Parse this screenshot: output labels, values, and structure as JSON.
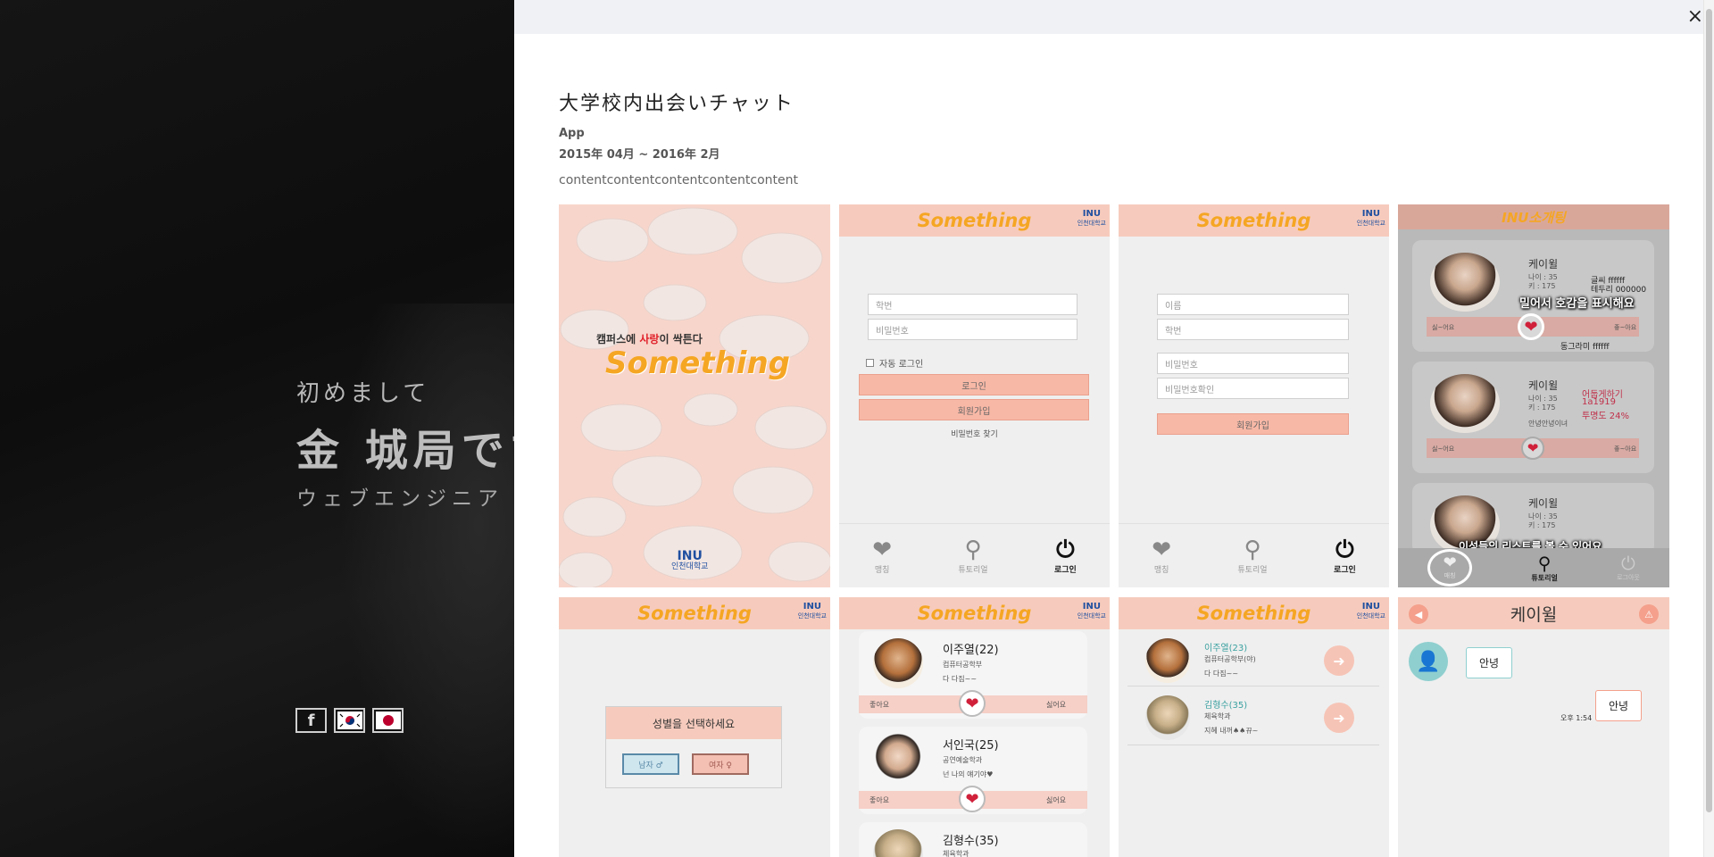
{
  "hero": {
    "greeting": "初めまして",
    "name": "金 城局です",
    "role": "ウェブエンジニア"
  },
  "social": {
    "facebook": "f",
    "korea_icon": "korea-flag-icon",
    "japan_icon": "japan-flag-icon"
  },
  "modal": {
    "close": "×",
    "title": "大学校内出会いチャット",
    "category": "App",
    "period": "2015年 04月 ~ 2016年 2月",
    "description": "contentcontentcontentcontentcontent"
  },
  "app": {
    "logo": "Something",
    "inu": "INU",
    "inu_sub": "인천대학교",
    "splash_tagline_pre": "캠퍼스에 ",
    "splash_tagline_red": "사랑",
    "splash_tagline_post": "이 싹튼다",
    "login": {
      "student_id": "학번",
      "password": "비밀번호",
      "auto_login": "자동 로그인",
      "login_btn": "로그인",
      "signup_btn": "회원가입",
      "find_pw": "비밀번호 찾기"
    },
    "signup": {
      "name": "이름",
      "student_id": "학번",
      "password": "비밀번호",
      "password_confirm": "비밀번호확인",
      "signup_btn": "회원가입"
    },
    "tabs": {
      "matching": "맹칭",
      "tutorial": "튜토리얼",
      "login": "로그인"
    },
    "intro": {
      "header": "INU소개팅",
      "name": "케이윌",
      "age": "나이 : 35",
      "height": "키 : 175",
      "note1a": "글씨 ffffff",
      "note1b": "테두리 000000",
      "caption1": "밀어서 호감을 표시해요",
      "like": "싫~어요",
      "dislike": "좋~아요",
      "comment1": "동그라미 ffffff",
      "note2a": "어둡게하기",
      "note2b": "1a1919",
      "note2c": "투명도 24%",
      "comment2": "안녕안녕이녀",
      "caption2": "이성들의 리스트를 볼 수 있어요",
      "tab_matching": "매칭",
      "tab_tutorial": "튜토리얼",
      "tab_logout": "로그아웃"
    },
    "gender": {
      "title": "성별을 선택하세요",
      "male": "남자 ♂",
      "female": "여자 ♀"
    },
    "list": [
      {
        "name": "이주열(22)",
        "dept": "컴퓨터공학부",
        "msg": "다 다짐~~",
        "like": "좋아요",
        "dislike": "싫어요"
      },
      {
        "name": "서인국(25)",
        "dept": "공연예술학과",
        "msg": "넌 나의 얘기야♥",
        "like": "좋아요",
        "dislike": "싫어요"
      },
      {
        "name": "김형수(35)",
        "dept": "체육학과"
      }
    ],
    "chatlist": [
      {
        "name": "이주열(23)",
        "dept": "컴퓨터공학부(야)",
        "msg": "다 다짐~~"
      },
      {
        "name": "김형수(35)",
        "dept": "체육학과",
        "msg": "지혜 내꺼♠♠뀨~"
      }
    ],
    "chat": {
      "name": "케이윌",
      "in_msg": "안녕",
      "out_msg": "안녕",
      "time": "오후 1:54"
    }
  }
}
